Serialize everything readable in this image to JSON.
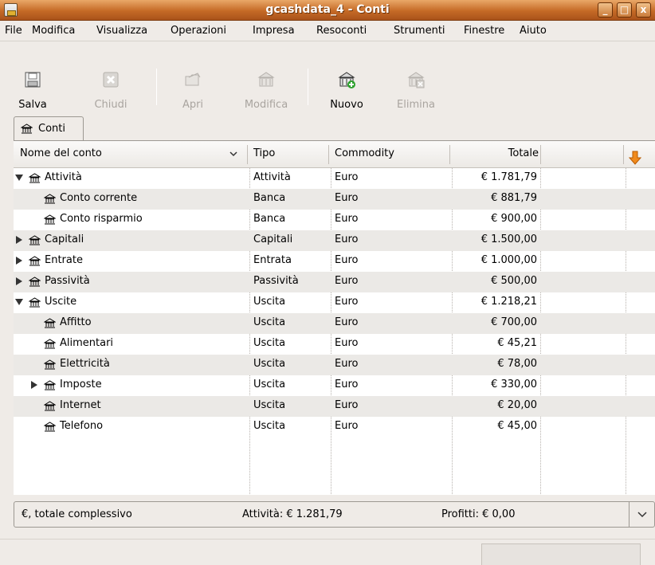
{
  "window": {
    "title": "gcashdata_4 - Conti",
    "controls": [
      "_",
      "□",
      "x"
    ]
  },
  "menu": {
    "items": [
      "File",
      "Modifica",
      "Visualizza",
      "Operazioni",
      "Impresa",
      "Resoconti",
      "Strumenti",
      "Finestre",
      "Aiuto"
    ]
  },
  "toolbar": {
    "buttons": [
      {
        "label": "Salva",
        "icon": "save-icon",
        "enabled": true
      },
      {
        "label": "Chiudi",
        "icon": "close-icon",
        "enabled": false
      },
      {
        "label": "Apri",
        "icon": "open-icon",
        "enabled": false
      },
      {
        "label": "Modifica",
        "icon": "edit-account-icon",
        "enabled": false
      },
      {
        "label": "Nuovo",
        "icon": "new-account-icon",
        "enabled": true
      },
      {
        "label": "Elimina",
        "icon": "delete-account-icon",
        "enabled": false
      }
    ]
  },
  "tab": {
    "label": "Conti",
    "icon": "bank-icon"
  },
  "columns": {
    "name": "Nome del conto",
    "type": "Tipo",
    "commodity": "Commodity",
    "total": "Totale"
  },
  "accounts": [
    {
      "name": "Attività",
      "type": "Attività",
      "commodity": "Euro",
      "total": "€ 1.781,79",
      "level": 0,
      "expander": "open"
    },
    {
      "name": "Conto corrente",
      "type": "Banca",
      "commodity": "Euro",
      "total": "€ 881,79",
      "level": 1,
      "expander": "none"
    },
    {
      "name": "Conto risparmio",
      "type": "Banca",
      "commodity": "Euro",
      "total": "€ 900,00",
      "level": 1,
      "expander": "none"
    },
    {
      "name": "Capitali",
      "type": "Capitali",
      "commodity": "Euro",
      "total": "€ 1.500,00",
      "level": 0,
      "expander": "closed"
    },
    {
      "name": "Entrate",
      "type": "Entrata",
      "commodity": "Euro",
      "total": "€ 1.000,00",
      "level": 0,
      "expander": "closed"
    },
    {
      "name": "Passività",
      "type": "Passività",
      "commodity": "Euro",
      "total": "€ 500,00",
      "level": 0,
      "expander": "closed"
    },
    {
      "name": "Uscite",
      "type": "Uscita",
      "commodity": "Euro",
      "total": "€ 1.218,21",
      "level": 0,
      "expander": "open"
    },
    {
      "name": "Affitto",
      "type": "Uscita",
      "commodity": "Euro",
      "total": "€ 700,00",
      "level": 1,
      "expander": "none"
    },
    {
      "name": "Alimentari",
      "type": "Uscita",
      "commodity": "Euro",
      "total": "€ 45,21",
      "level": 1,
      "expander": "none"
    },
    {
      "name": "Elettricità",
      "type": "Uscita",
      "commodity": "Euro",
      "total": "€ 78,00",
      "level": 1,
      "expander": "none"
    },
    {
      "name": "Imposte",
      "type": "Uscita",
      "commodity": "Euro",
      "total": "€ 330,00",
      "level": 1,
      "expander": "closed"
    },
    {
      "name": "Internet",
      "type": "Uscita",
      "commodity": "Euro",
      "total": "€ 20,00",
      "level": 1,
      "expander": "none"
    },
    {
      "name": "Telefono",
      "type": "Uscita",
      "commodity": "Euro",
      "total": "€ 45,00",
      "level": 1,
      "expander": "none"
    }
  ],
  "summary": {
    "label": "€, totale complessivo",
    "assets": "Attività: € 1.281,79",
    "profit": "Profitti: € 0,00"
  },
  "colors": {
    "titlebar": "#c56a26",
    "row_alt": "#ebe9e6",
    "column_selector_arrow": "#f08a1c"
  }
}
